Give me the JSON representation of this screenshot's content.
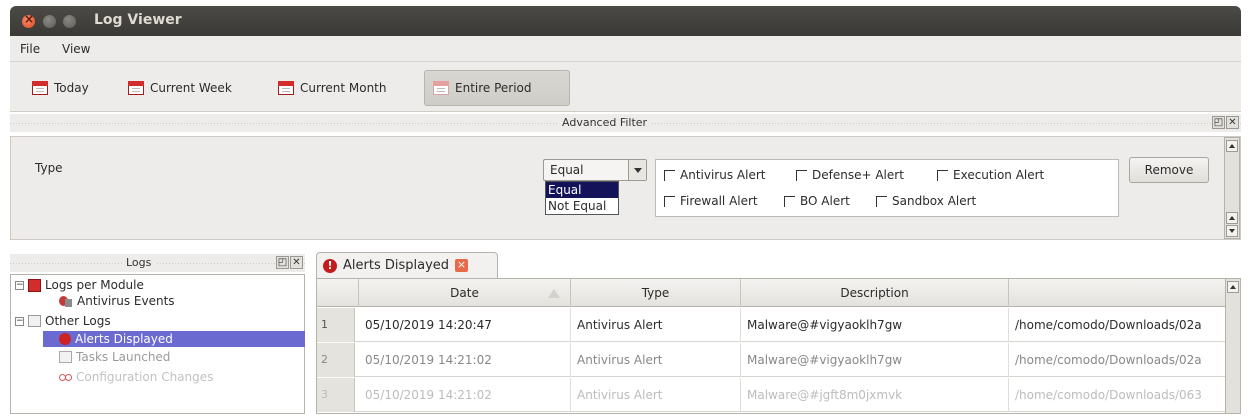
{
  "window": {
    "title": "Log Viewer"
  },
  "menu": {
    "file": "File",
    "view": "View"
  },
  "toolbar": {
    "today": "Today",
    "current_week": "Current Week",
    "current_month": "Current Month",
    "entire_period": "Entire Period"
  },
  "advanced_filter": {
    "title": "Advanced Filter",
    "type_label": "Type",
    "operator_value": "Equal",
    "operator_options": [
      "Equal",
      "Not Equal"
    ],
    "alerts": {
      "antivirus": "Antivirus Alert",
      "defense": "Defense+ Alert",
      "execution": "Execution Alert",
      "firewall": "Firewall Alert",
      "bo": "BO Alert",
      "sandbox": "Sandbox Alert"
    },
    "remove_label": "Remove"
  },
  "logs_panel": {
    "title": "Logs",
    "tree": {
      "logs_per_module": "Logs per Module",
      "antivirus_events": "Antivirus Events",
      "other_logs": "Other Logs",
      "alerts_displayed": "Alerts Displayed",
      "tasks_launched": "Tasks Launched",
      "configuration_changes": "Configuration Changes"
    }
  },
  "tab": {
    "label": "Alerts Displayed"
  },
  "table": {
    "columns": [
      "Date",
      "Type",
      "Description",
      ""
    ],
    "rows": [
      {
        "num": "1",
        "date": "05/10/2019 14:20:47",
        "type": "Antivirus Alert",
        "description": "Malware@#vigyaoklh7gw",
        "path": "/home/comodo/Downloads/02a"
      },
      {
        "num": "2",
        "date": "05/10/2019 14:21:02",
        "type": "Antivirus Alert",
        "description": "Malware@#vigyaoklh7gw",
        "path": "/home/comodo/Downloads/02a"
      },
      {
        "num": "3",
        "date": "05/10/2019 14:21:02",
        "type": "Antivirus Alert",
        "description": "Malware@#jgft8m0jxmvk",
        "path": "/home/comodo/Downloads/063"
      }
    ]
  },
  "colors": {
    "titlebar": "#3f3e3a",
    "selection": "#6a6ad0",
    "dropdown_highlight": "#14135a",
    "alert_red": "#c41c1c"
  }
}
